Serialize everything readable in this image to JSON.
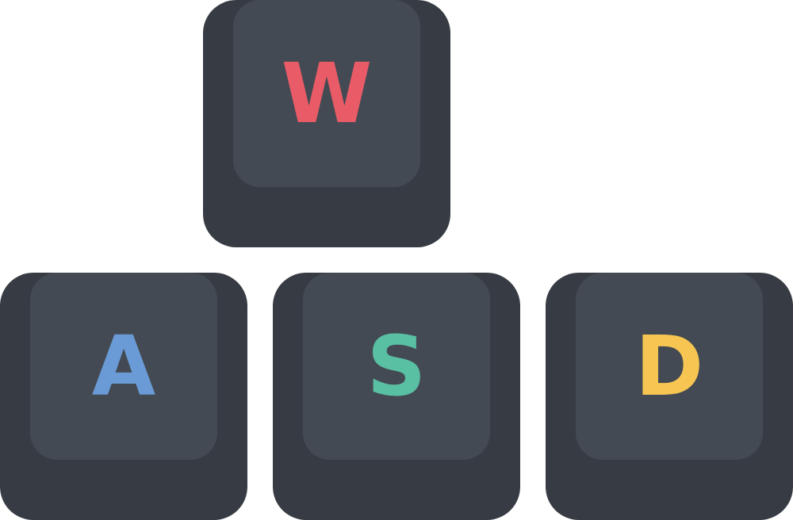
{
  "keys": [
    {
      "id": "w",
      "label": "W",
      "color": "#e95b67"
    },
    {
      "id": "a",
      "label": "A",
      "color": "#6a9bd6"
    },
    {
      "id": "s",
      "label": "S",
      "color": "#59c0a4"
    },
    {
      "id": "d",
      "label": "D",
      "color": "#f7c652"
    }
  ],
  "colors": {
    "key_base": "#373c44",
    "key_top": "#444a53",
    "background": "#ffffff"
  }
}
